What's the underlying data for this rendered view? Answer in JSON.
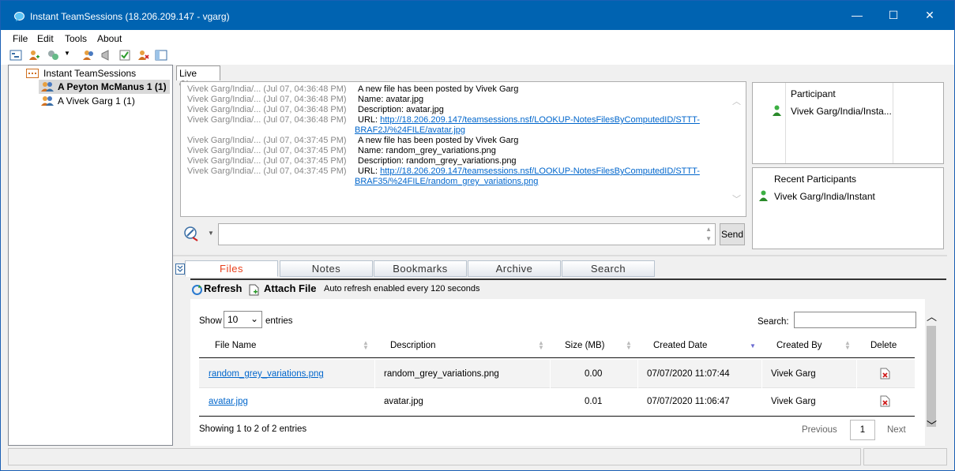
{
  "window": {
    "title": "Instant TeamSessions (18.206.209.147 - vgarg)",
    "minimize": "—",
    "maximize": "☐",
    "close": "✕"
  },
  "menu": [
    "File",
    "Edit",
    "Tools",
    "About"
  ],
  "tree": {
    "root": "Instant TeamSessions",
    "items": [
      {
        "label": "A Peyton McManus 1 (1)",
        "selected": true
      },
      {
        "label": "A Vivek Garg 1 (1)",
        "selected": false
      }
    ]
  },
  "chat": {
    "tab_label": "Live Chat",
    "messages": [
      {
        "who": "Vivek Garg/India/...  (Jul 07, 04:36:48 PM)",
        "text": "A new file has been posted by Vivek Garg"
      },
      {
        "who": "Vivek Garg/India/...  (Jul 07, 04:36:48 PM)",
        "text": "Name: avatar.jpg"
      },
      {
        "who": "Vivek Garg/India/...  (Jul 07, 04:36:48 PM)",
        "text": "Description: avatar.jpg"
      },
      {
        "who": "Vivek Garg/India/...  (Jul 07, 04:36:48 PM)",
        "url_prefix": "URL: ",
        "url1": "http://18.206.209.147/teamsessions.nsf/LOOKUP-NotesFilesByComputedID/STTT-",
        "url2": "BRAF2J/%24FILE/avatar.jpg"
      },
      {
        "who": "Vivek Garg/India/...  (Jul 07, 04:37:45 PM)",
        "text": "A new file has been posted by Vivek Garg"
      },
      {
        "who": "Vivek Garg/India/...  (Jul 07, 04:37:45 PM)",
        "text": "Name: random_grey_variations.png"
      },
      {
        "who": "Vivek Garg/India/...  (Jul 07, 04:37:45 PM)",
        "text": "Description: random_grey_variations.png"
      },
      {
        "who": "Vivek Garg/India/...  (Jul 07, 04:37:45 PM)",
        "url_prefix": "URL: ",
        "url1": "http://18.206.209.147/teamsessions.nsf/LOOKUP-NotesFilesByComputedID/STTT-",
        "url2": "BRAF35/%24FILE/random_grey_variations.png"
      }
    ],
    "send_label": "Send"
  },
  "participants": {
    "header": "Participant",
    "name": "Vivek Garg/India/Insta...",
    "recent_header": "Recent Participants",
    "recent_name": "Vivek Garg/India/Instant"
  },
  "bottom_tabs": [
    "Files",
    "Notes",
    "Bookmarks",
    "Archive",
    "Search"
  ],
  "files": {
    "refresh_label": "Refresh",
    "attach_label": "Attach File",
    "auto_refresh": "Auto refresh enabled every 120 seconds",
    "show_label": "Show",
    "show_value": "10",
    "entries_label": "entries",
    "search_label": "Search:",
    "columns": [
      "File Name",
      "Description",
      "Size (MB)",
      "Created Date",
      "Created By",
      "Delete"
    ],
    "rows": [
      {
        "file_name": "random_grey_variations.png",
        "description": "random_grey_variations.png",
        "size": "0.00",
        "created_date": "07/07/2020 11:07:44",
        "created_by": "Vivek Garg"
      },
      {
        "file_name": "avatar.jpg",
        "description": "avatar.jpg",
        "size": "0.01",
        "created_date": "07/07/2020 11:06:47",
        "created_by": "Vivek Garg"
      }
    ],
    "showing": "Showing 1 to 2 of 2 entries",
    "previous": "Previous",
    "page": "1",
    "next": "Next"
  },
  "colors": {
    "titlebar": "#0063b1",
    "active_tab": "#e8401c",
    "link": "#0066cc"
  }
}
